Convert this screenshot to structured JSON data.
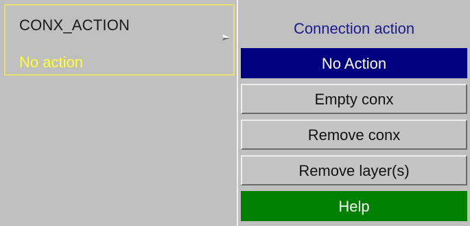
{
  "field": {
    "label": "CONX_ACTION",
    "value": "No action"
  },
  "menu": {
    "title": "Connection action",
    "items": [
      {
        "label": "No Action",
        "selected": true
      },
      {
        "label": "Empty conx",
        "selected": false
      },
      {
        "label": "Remove conx",
        "selected": false
      },
      {
        "label": "Remove layer(s)",
        "selected": false
      }
    ],
    "help_label": "Help"
  },
  "colors": {
    "panel_background": "#c0c0c0",
    "field_border": "#e8e070",
    "field_value": "#ffff33",
    "menu_title": "#1a1a8c",
    "selected_background": "#000080",
    "help_background": "#008000"
  },
  "icons": {
    "pointer": "cursor-pointer-icon"
  }
}
